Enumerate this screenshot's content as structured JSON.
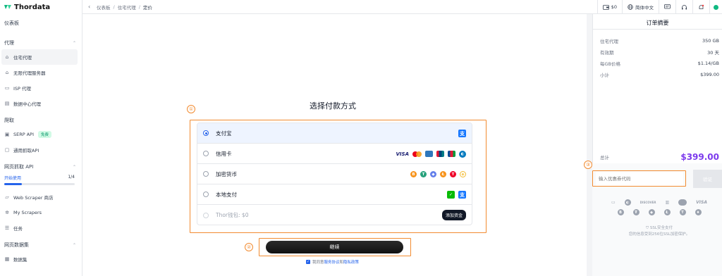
{
  "app": {
    "logo_text": "Thordata"
  },
  "sidebar": {
    "dashboard": "仪表板",
    "proxy_section": "代理",
    "proxy_items": [
      {
        "label": "住宅代理",
        "icon": "home-icon"
      },
      {
        "label": "无限代理服务器",
        "icon": "home-infinite-icon"
      },
      {
        "label": "ISP 代理",
        "icon": "isp-icon"
      },
      {
        "label": "数据中心代理",
        "icon": "datacenter-icon"
      }
    ],
    "scrape_section": "爬取",
    "scrape_items": [
      {
        "label": "SERP API",
        "badge": "免费",
        "icon": "serp-icon"
      },
      {
        "label": "通用抓取API",
        "icon": "scraper-api-icon"
      }
    ],
    "web_api_section": "网页抓取 API",
    "getting_started": "开始使用",
    "getting_started_count": "1/4",
    "getting_started_progress": 0.25,
    "web_api_items": [
      {
        "label": "Web Scraper 商店",
        "icon": "store-icon"
      },
      {
        "label": "My Scrapers",
        "icon": "my-scrapers-icon"
      },
      {
        "label": "任务",
        "icon": "tasks-icon"
      }
    ],
    "dataset_section": "网页数据集",
    "dataset_items": [
      {
        "label": "数据集",
        "icon": "dataset-icon"
      }
    ]
  },
  "topbar": {
    "breadcrumb": [
      "仪表板",
      "住宅代理",
      "定价"
    ],
    "balance": "$0",
    "language": "简体中文"
  },
  "payment": {
    "title": "选择付款方式",
    "methods": [
      {
        "label": "支付宝",
        "selected": true,
        "disabled": false
      },
      {
        "label": "信用卡",
        "selected": false,
        "disabled": false
      },
      {
        "label": "加密货币",
        "selected": false,
        "disabled": false
      },
      {
        "label": "本地支付",
        "selected": false,
        "disabled": false
      },
      {
        "label": "Thor钱包: $0",
        "selected": false,
        "disabled": true
      }
    ],
    "card_brands": [
      "VISA",
      "Mastercard",
      "American Express",
      "UnionPay",
      "JCB",
      "Diners Club"
    ],
    "crypto_coins": [
      "BTC",
      "USDT",
      "ETH",
      "LTC",
      "TRX",
      "BNB"
    ],
    "recharge_label": "添加资金",
    "continue_label": "继续",
    "agree_prefix": "我同意",
    "agree_terms": "服务协议",
    "agree_and": "和",
    "agree_privacy": "隐私政策"
  },
  "annotations": [
    "①",
    "②",
    "③"
  ],
  "summary": {
    "title": "订单摘要",
    "rows": [
      {
        "label": "住宅代理",
        "value": "350 GB"
      },
      {
        "label": "有效期",
        "value": "30 天"
      },
      {
        "label": "每GB价格",
        "value": "$1.14/GB"
      },
      {
        "label": "小计",
        "value": "$399.00"
      }
    ],
    "total_label": "总计",
    "total_value": "$399.00",
    "coupon_placeholder": "输入优惠券代码",
    "verify_label": "验证",
    "payment_logos_row1": [
      "AMEX",
      "DINERS",
      "DISCOVER",
      "JCB",
      "MC",
      "VISA"
    ],
    "payment_logos_row2": [
      "B",
      "₮",
      "◆",
      "Ł",
      "T",
      "♦"
    ],
    "secure_line1": "SSL安全支付",
    "secure_line2": "您的信息受到256位SSL加密保护。"
  },
  "colors": {
    "accent": "#2563eb",
    "total": "#7c3aed",
    "annotation": "#f28b30"
  }
}
